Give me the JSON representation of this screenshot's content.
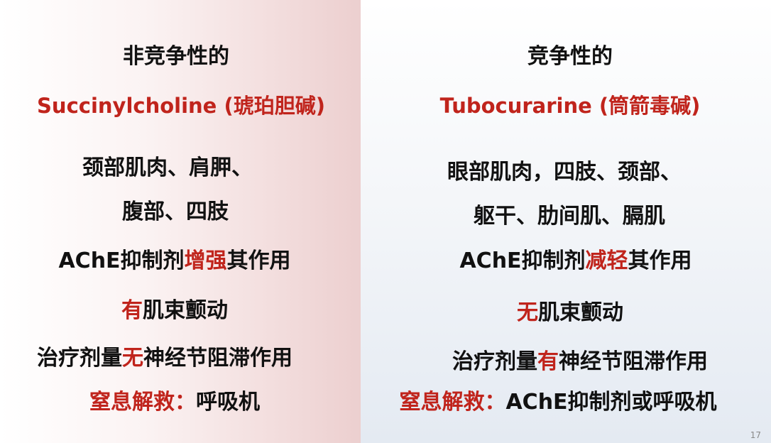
{
  "left": {
    "heading": "非竞争性的",
    "drug": "Succinylcholine (琥珀胆碱)",
    "muscles_line1": "颈部肌肉、肩胛、",
    "muscles_line2": "腹部、四肢",
    "ache": {
      "prefix": "AChE抑制剂",
      "highlight": "增强",
      "suffix": "其作用"
    },
    "fasciculation": {
      "highlight": "有",
      "rest": "肌束颤动"
    },
    "ganglion": {
      "prefix": "治疗剂量",
      "highlight": "无",
      "suffix": "神经节阻滞作用"
    },
    "rescue": {
      "label": "窒息解救：",
      "value": "呼吸机"
    }
  },
  "right": {
    "heading": "竞争性的",
    "drug": "Tubocurarine (筒箭毒碱)",
    "muscles_line1": "眼部肌肉，四肢、颈部、",
    "muscles_line2": "躯干、肋间肌、膈肌",
    "ache": {
      "prefix": "AChE抑制剂",
      "highlight": "减轻",
      "suffix": "其作用"
    },
    "fasciculation": {
      "highlight": "无",
      "rest": "肌束颤动"
    },
    "ganglion": {
      "prefix": "治疗剂量",
      "highlight": "有",
      "suffix": "神经节阻滞作用"
    },
    "rescue": {
      "label": "窒息解救：",
      "value": "AChE抑制剂或呼吸机"
    }
  },
  "page_number": "17",
  "colors": {
    "accent_red": "#c0241c",
    "text": "#111111"
  }
}
